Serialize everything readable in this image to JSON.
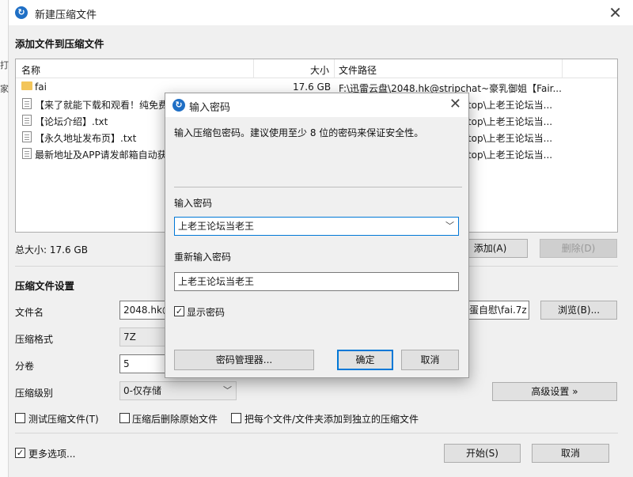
{
  "window": {
    "title": "新建压缩文件",
    "edge_glyphs": [
      "打",
      "家"
    ]
  },
  "files": {
    "section_title": "添加文件到压缩文件",
    "columns": [
      "名称",
      "大小",
      "文件路径"
    ],
    "rows": [
      {
        "icon": "folder-icon",
        "name": "fai",
        "size": "17.6 GB",
        "path": "F:\\迅雷云盘\\2048.hk@stripchat~豪乳御姐【Fair..."
      },
      {
        "icon": "file-icon",
        "name": "【来了就能下载和观看！纯免费",
        "size": "",
        "path": "ktop\\上老王论坛当..."
      },
      {
        "icon": "file-icon",
        "name": "【论坛介绍】.txt",
        "size": "",
        "path": "ktop\\上老王论坛当..."
      },
      {
        "icon": "file-icon",
        "name": "【永久地址发布页】.txt",
        "size": "",
        "path": "ktop\\上老王论坛当..."
      },
      {
        "icon": "file-icon",
        "name": "最新地址及APP请发邮箱自动获",
        "size": "",
        "path": "ktop\\上老王论坛当..."
      }
    ],
    "total_size": "总大小: 17.6 GB",
    "add_button": "添加(A)",
    "delete_button": "删除(D)"
  },
  "settings": {
    "section_title": "压缩文件设置",
    "filename_label": "文件名",
    "filename_value": "2048.hk@",
    "filename_tail": "蛋自慰\\fai.7z",
    "browse_button": "浏览(B)...",
    "format_label": "压缩格式",
    "format_value": "7Z",
    "volume_label": "分卷",
    "volume_value": "5",
    "level_label": "压缩级别",
    "level_value": "0-仅存储",
    "advanced_button": "高级设置 »",
    "test_checkbox": "测试压缩文件(T)",
    "delete_source_checkbox": "压缩后删除原始文件",
    "separate_checkbox": "把每个文件/文件夹添加到独立的压缩文件",
    "more_options": "更多选项...",
    "start_button": "开始(S)",
    "cancel_button": "取消"
  },
  "password_dialog": {
    "title": "输入密码",
    "prompt": "输入压缩包密码。建议使用至少 8 位的密码来保证安全性。",
    "password_label": "输入密码",
    "password_value": "上老王论坛当老王",
    "confirm_label": "重新输入密码",
    "confirm_value": "上老王论坛当老王",
    "show_password": "显示密码",
    "manager_button": "密码管理器...",
    "ok_button": "确定",
    "cancel_button": "取消"
  },
  "colors": {
    "accent": "#0078d7",
    "app_icon": "#1f6fc5",
    "folder": "#f3c55a"
  }
}
